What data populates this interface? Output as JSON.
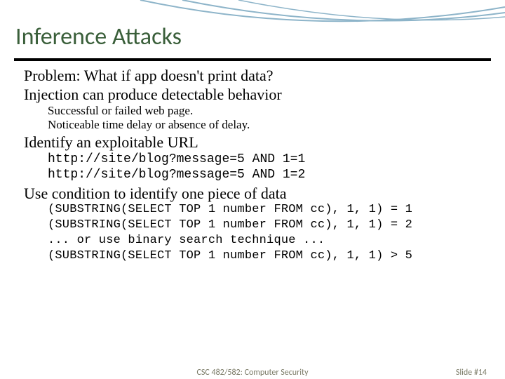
{
  "title": "Inference Attacks",
  "body": {
    "p1": "Problem: What if app doesn't print data?",
    "p2": "Injection can produce detectable behavior",
    "p2_sub1": "Successful or failed web page.",
    "p2_sub2": "Noticeable time delay or absence of delay.",
    "p3": "Identify an exploitable URL",
    "url1": "http://site/blog?message=5 AND 1=1",
    "url2": "http://site/blog?message=5 AND 1=2",
    "p4": "Use condition to identify one piece of data",
    "sql1": "(SUBSTRING(SELECT TOP 1 number FROM cc), 1, 1) = 1",
    "sql2": "(SUBSTRING(SELECT TOP 1 number FROM cc), 1, 1) = 2",
    "sql3": "... or use binary search technique ...",
    "sql4": "(SUBSTRING(SELECT TOP 1 number FROM cc), 1, 1) > 5"
  },
  "footer": {
    "center": "CSC 482/582: Computer Security",
    "right": "Slide #14"
  }
}
